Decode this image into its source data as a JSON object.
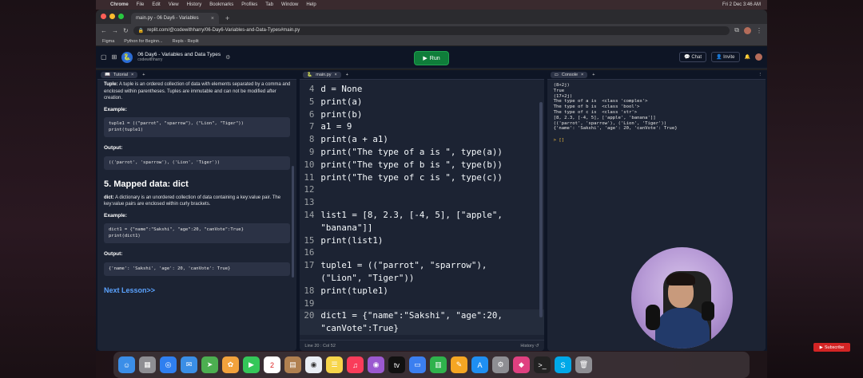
{
  "menubar": {
    "app": "Chrome",
    "items": [
      "File",
      "Edit",
      "View",
      "History",
      "Bookmarks",
      "Profiles",
      "Tab",
      "Window",
      "Help"
    ],
    "clock": "Fri 2 Dec  3:46 AM"
  },
  "browser": {
    "tab_title": "main.py - 06 Day6 - Variables",
    "url": "replit.com/@codewithharry/06-Day6-Variables-and-Data-Types#main.py",
    "bookmarks": [
      "Figma",
      "Python for Beginn...",
      "Repls - Replit"
    ]
  },
  "replit": {
    "project_title": "06 Day6 - Variables and Data Types",
    "owner": "codewithharry",
    "run_label": "Run",
    "chat_label": "Chat",
    "invite_label": "Invite"
  },
  "tutorial": {
    "tab_label": "Tutorial",
    "intro_term": "Tuple:",
    "intro_text": " A tuple is an ordered collection of data with elements separated by a comma and enclosed within parentheses. Tuples are immutable and can not be modified after creation.",
    "example_label_1": "Example:",
    "code_1_line_1": "tuple1 = ((\"parrot\", \"sparrow\"), (\"Lion\", \"Tiger\"))",
    "code_1_line_2": "print(tuple1)",
    "output_label_1": "Output:",
    "output_1": "(('parrot', 'sparrow'), ('Lion', 'Tiger'))",
    "section_heading": "5. Mapped data: dict",
    "dict_term": "dict:",
    "dict_text": " A dictionary is an unordered collection of data containing a key:value pair. The key:value pairs are enclosed within curly brackets.",
    "example_label_2": "Example:",
    "code_2_line_1": "dict1 = {\"name\":\"Sakshi\", \"age\":20, \"canVote\":True}",
    "code_2_line_2": "print(dict1)",
    "output_label_2": "Output:",
    "output_2": "{'name': 'Sakshi', 'age': 20, 'canVote': True}",
    "next_label": "Next Lesson>>"
  },
  "editor": {
    "tab_label": "main.py",
    "lines": [
      {
        "n": "4",
        "t": "d = None"
      },
      {
        "n": "5",
        "t": "print(a)"
      },
      {
        "n": "6",
        "t": "print(b)"
      },
      {
        "n": "7",
        "t": "a1 = 9"
      },
      {
        "n": "8",
        "t": "print(a + a1)"
      },
      {
        "n": "9",
        "t": "print(\"The type of a is \", type(a))"
      },
      {
        "n": "10",
        "t": "print(\"The type of b is \", type(b))"
      },
      {
        "n": "11",
        "t": "print(\"The type of c is \", type(c))"
      },
      {
        "n": "12",
        "t": ""
      },
      {
        "n": "13",
        "t": ""
      },
      {
        "n": "14",
        "t": "list1 = [8, 2.3, [-4, 5], [\"apple\","
      },
      {
        "n": "",
        "t": "\"banana\"]]"
      },
      {
        "n": "15",
        "t": "print(list1)"
      },
      {
        "n": "16",
        "t": ""
      },
      {
        "n": "17",
        "t": "tuple1 = ((\"parrot\", \"sparrow\"),"
      },
      {
        "n": "",
        "t": "(\"Lion\", \"Tiger\"))"
      },
      {
        "n": "18",
        "t": "print(tuple1)"
      },
      {
        "n": "19",
        "t": ""
      },
      {
        "n": "20",
        "t": "dict1 = {\"name\":\"Sakshi\", \"age\":20,"
      },
      {
        "n": "",
        "t": "\"canVote\":True}"
      }
    ],
    "status": "Line 20 : Col 52",
    "history_label": "History"
  },
  "console": {
    "tab_label": "Console",
    "output": "(8+2j)\nTrue\n(17+2j)\nThe type of a is  <class 'complex'>\nThe type of b is  <class 'bool'>\nThe type of c is  <class 'str'>\n[8, 2.3, [-4, 5], ['apple', 'banana']]\n(('parrot', 'sparrow'), ('Lion', 'Tiger'))\n{'name': 'Sakshi', 'age': 20, 'canVote': True}",
    "prompt": "> []"
  },
  "overlay": {
    "subscribe_label": "Subscribe"
  },
  "dock_icons": [
    "finder-icon",
    "launchpad-icon",
    "safari-icon",
    "mail-icon",
    "maps-icon",
    "photos-icon",
    "facetime-icon",
    "calendar-icon",
    "files-icon",
    "chrome-icon",
    "notes-icon",
    "music-icon",
    "podcasts-icon",
    "tv-icon",
    "keynote-icon",
    "numbers-icon",
    "pages-icon",
    "appstore-icon",
    "settings-icon",
    "app-icon",
    "terminal-icon",
    "skype-icon",
    "trash-icon"
  ],
  "calendar_day": "2"
}
